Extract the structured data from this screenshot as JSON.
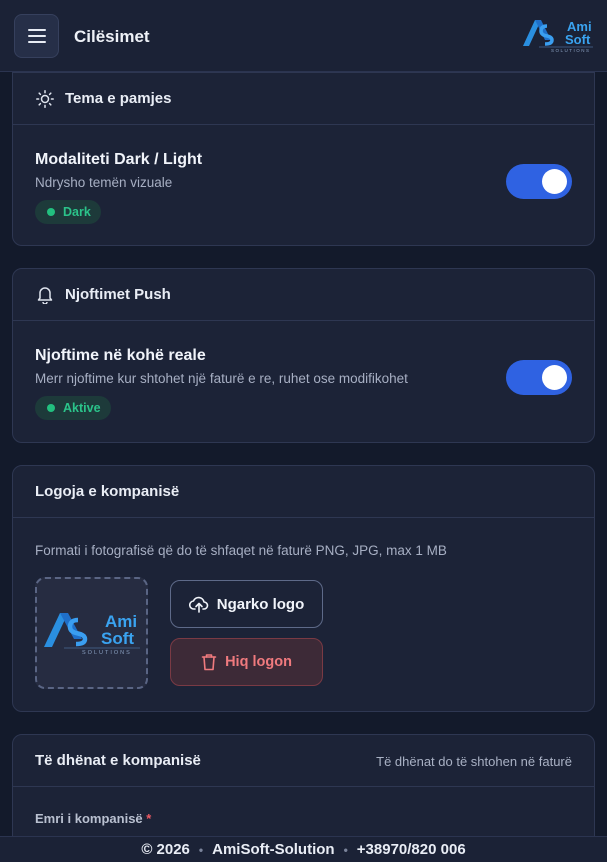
{
  "header": {
    "title": "Cilësimet",
    "menu_icon": "hamburger-icon",
    "logo": {
      "text_top": "Ami",
      "text_bottom": "Soft",
      "sub": "SOLUTIONS"
    }
  },
  "theme_card": {
    "title": "Tema e pamjes",
    "icon": "sun-icon",
    "setting_title": "Modaliteti Dark / Light",
    "setting_desc": "Ndrysho temën vizuale",
    "badge": "Dark",
    "toggle_on": true
  },
  "push_card": {
    "title": "Njoftimet Push",
    "icon": "bell-icon",
    "setting_title": "Njoftime në kohë reale",
    "setting_desc": "Merr njoftime kur shtohet një faturë e re, ruhet ose modifikohet",
    "badge": "Aktive",
    "toggle_on": true
  },
  "logo_card": {
    "title": "Logoja e kompanisë",
    "description": "Formati i fotografisë që do të shfaqet në faturë PNG, JPG, max 1 MB",
    "upload_label": "Ngarko logo",
    "remove_label": "Hiq logon",
    "preview": {
      "text_top": "Ami",
      "text_bottom": "Soft",
      "sub": "SOLUTIONS"
    }
  },
  "company_card": {
    "title": "Të dhënat e kompanisë",
    "note": "Të dhënat do të shtohen në faturë",
    "field_label": "Emri i kompanisë",
    "required_mark": "*"
  },
  "footer": {
    "copyright": "© 2026",
    "company": "AmiSoft-Solution",
    "phone": "+38970/820 006"
  },
  "colors": {
    "accent": "#2f62e2",
    "success": "#22c07f",
    "danger": "#f07a7e",
    "background": "#131a2b",
    "card": "#1c2337"
  }
}
